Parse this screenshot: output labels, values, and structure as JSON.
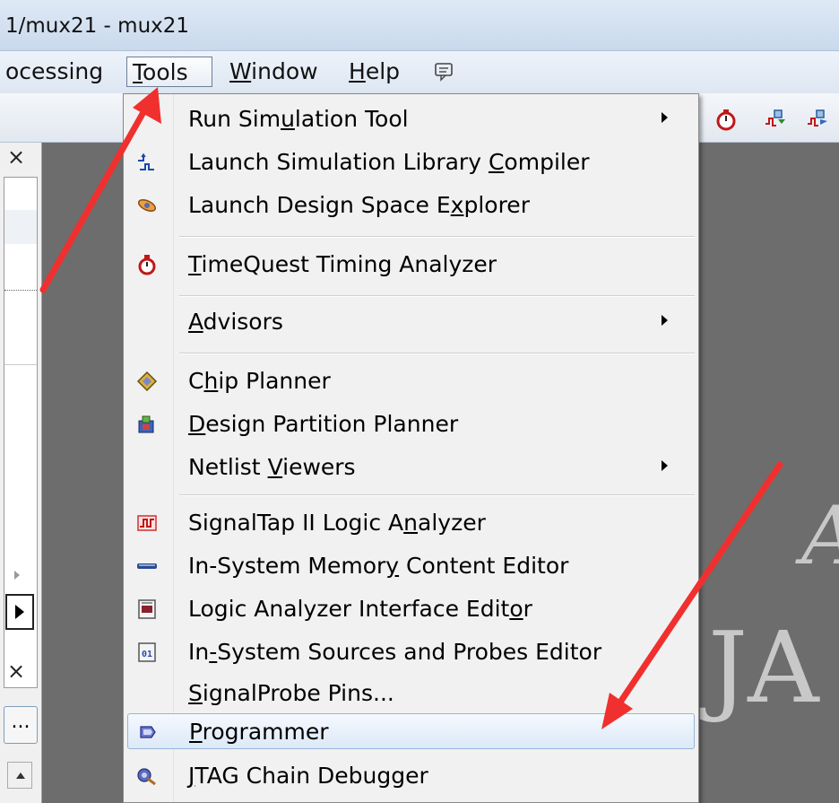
{
  "window": {
    "title": "1/mux21 - mux21"
  },
  "menubar": {
    "items": [
      {
        "label_pre": "ocessing",
        "key": "",
        "label_post": ""
      },
      {
        "label_pre": "",
        "key": "T",
        "label_post": "ools"
      },
      {
        "label_pre": "",
        "key": "W",
        "label_post": "indow"
      },
      {
        "label_pre": "",
        "key": "H",
        "label_post": "elp"
      }
    ]
  },
  "tools_menu": {
    "items": [
      {
        "pre": "Run Sim",
        "key": "u",
        "post": "lation Tool",
        "submenu": true,
        "icon": "none"
      },
      {
        "pre": "Launch Simulation Library ",
        "key": "C",
        "post": "ompiler",
        "submenu": false,
        "icon": "sim-library-icon"
      },
      {
        "pre": "Launch Design Space E",
        "key": "x",
        "post": "plorer",
        "submenu": false,
        "icon": "design-space-icon"
      },
      {
        "pre": "",
        "key": "T",
        "post": "imeQuest Timing Analyzer",
        "submenu": false,
        "icon": "stopwatch-icon"
      },
      {
        "pre": "",
        "key": "A",
        "post": "dvisors",
        "submenu": true,
        "icon": "none"
      },
      {
        "pre": "C",
        "key": "h",
        "post": "ip Planner",
        "submenu": false,
        "icon": "chip-planner-icon"
      },
      {
        "pre": "",
        "key": "D",
        "post": "esign Partition Planner",
        "submenu": false,
        "icon": "partition-icon"
      },
      {
        "pre": "Netlist ",
        "key": "V",
        "post": "iewers",
        "submenu": true,
        "icon": "none"
      },
      {
        "pre": "SignalTap II Logic A",
        "key": "n",
        "post": "alyzer",
        "submenu": false,
        "icon": "signaltap-icon"
      },
      {
        "pre": "In-System Memor",
        "key": "y",
        "post": " Content Editor",
        "submenu": false,
        "icon": "memory-icon"
      },
      {
        "pre": "Logic Analyzer Interface Edit",
        "key": "o",
        "post": "r",
        "submenu": false,
        "icon": "lai-icon"
      },
      {
        "pre": "In",
        "key": "-",
        "post": "System Sources and Probes Editor",
        "submenu": false,
        "icon": "sources-probes-icon"
      },
      {
        "pre": "",
        "key": "S",
        "post": "ignalProbe Pins...",
        "submenu": false,
        "icon": "none"
      },
      {
        "pre": "",
        "key": "P",
        "post": "rogrammer",
        "submenu": false,
        "icon": "programmer-icon"
      },
      {
        "pre": "",
        "key": "J",
        "post": "TAG Chain Debugger",
        "submenu": false,
        "icon": "jtag-icon"
      }
    ]
  },
  "leftpanel": {
    "close_glyph": "×",
    "ellipsis": "..."
  },
  "background": {
    "letter_top": "A",
    "letters_bottom": "JA"
  },
  "colors": {
    "annotation_arrow": "#f0302e",
    "highlight_border": "#98b6d9"
  }
}
